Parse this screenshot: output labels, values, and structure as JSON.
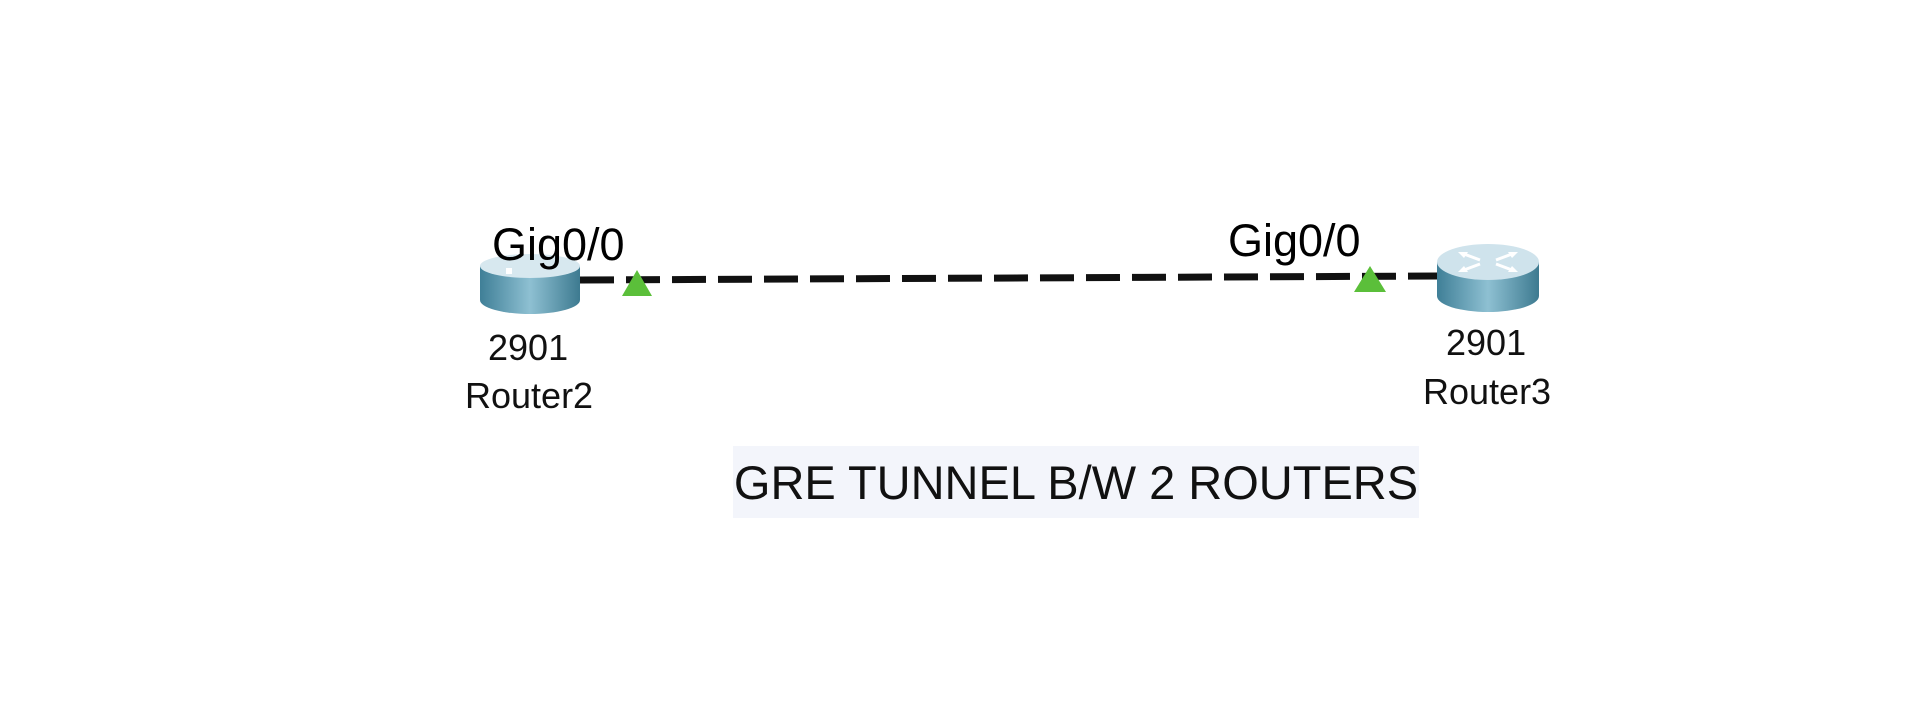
{
  "topology": {
    "devices": [
      {
        "id": "router2",
        "model": "2901",
        "name": "Router2",
        "interface_label": "Gig0/0"
      },
      {
        "id": "router3",
        "model": "2901",
        "name": "Router3",
        "interface_label": "Gig0/0"
      }
    ],
    "link": {
      "style": "dashed",
      "color": "#111111",
      "endpoint_status_color": "#5bbf3a",
      "endpoint_status": "up"
    },
    "note": "GRE TUNNEL B/W 2 ROUTERS"
  },
  "colors": {
    "router_body": "#5a93a8",
    "router_top": "#cfe3ec",
    "link_up": "#5bbf3a"
  }
}
